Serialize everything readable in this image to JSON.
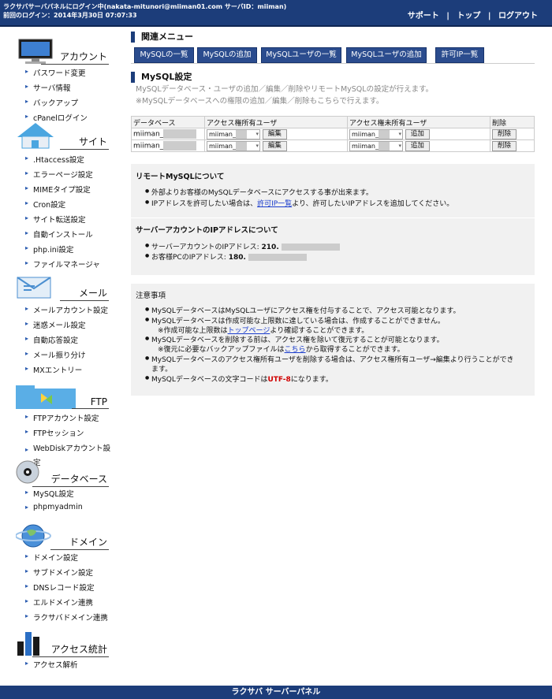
{
  "header": {
    "login_line1": "ラクサバサーバパネルにログイン中(nakata-mitunori@miiman01.com サーバID：miiman)",
    "login_line2": "前回のログイン：2014年3月30日 07:07:33",
    "links": [
      "サポート",
      "トップ",
      "ログアウト"
    ],
    "separator": "|"
  },
  "sidebar": {
    "account": {
      "title": "アカウント",
      "icon": "monitor-icon",
      "items": [
        "パスワード変更",
        "サーバ情報",
        "バックアップ",
        "cPanelログイン"
      ]
    },
    "site": {
      "title": "サイト",
      "icon": "house-icon",
      "items": [
        ".Htaccess設定",
        "エラーページ設定",
        "MIMEタイプ設定",
        "Cron設定",
        "サイト転送設定",
        "自動インストール",
        "php.ini設定",
        "ファイルマネージャ"
      ]
    },
    "mail": {
      "title": "メール",
      "icon": "envelope-icon",
      "items": [
        "メールアカウント設定",
        "迷惑メール設定",
        "自動応答設定",
        "メール振り分け",
        "MXエントリー"
      ]
    },
    "ftp": {
      "title": "FTP",
      "icon": "folder-icon",
      "items": [
        "FTPアカウント設定",
        "FTPセッション",
        "WebDiskアカウント設定"
      ]
    },
    "database": {
      "title": "データベース",
      "icon": "disc-icon",
      "items": [
        "MySQL設定",
        "phpmyadmin"
      ]
    },
    "domain": {
      "title": "ドメイン",
      "icon": "globe-icon",
      "items": [
        "ドメイン設定",
        "サブドメイン設定",
        "DNSレコード設定",
        "エルドメイン連携",
        "ラクサバドメイン連携"
      ]
    },
    "stats": {
      "title": "アクセス統計",
      "icon": "bar-chart-icon",
      "items": [
        "アクセス解析"
      ]
    }
  },
  "related": {
    "heading": "関連メニュー",
    "tabs": [
      "MySQLの一覧",
      "MySQLの追加",
      "MySQLユーザの一覧",
      "MySQLユーザの追加",
      "許可IP一覧"
    ]
  },
  "mysql": {
    "heading": "MySQL設定",
    "desc1": "MySQLデータベース・ユーザの追加／編集／削除やリモートMySQLの設定が行えます。",
    "desc2": "※MySQLデータベースへの権限の追加／編集／削除もこちらで行えます。",
    "table": {
      "headers": [
        "データベース",
        "アクセス権所有ユーザ",
        "アクセス権未所有ユーザ",
        "削除"
      ],
      "rows": [
        {
          "db": "miiman_",
          "owner": "miiman_",
          "nonowner": "miiman_",
          "edit": "編集",
          "add": "追加",
          "delete": "削除"
        },
        {
          "db": "miiman_",
          "owner": "miiman_",
          "nonowner": "miiman_",
          "edit": "編集",
          "add": "追加",
          "delete": "削除"
        }
      ]
    }
  },
  "remote": {
    "title": "リモートMySQLについて",
    "b1": "外部よりお客様のMySQLデータベースにアクセスする事が出来ます。",
    "b2_pre": "IPアドレスを許可したい場合は、",
    "b2_link": "許可IP一覧",
    "b2_post": "より、許可したいIPアドレスを追加してください。",
    "ip_title": "サーバーアカウントのIPアドレスについて",
    "ip1_label": "サーバーアカウントのIPアドレス: ",
    "ip1_value": "210.",
    "ip2_label": "お客様PCのIPアドレス: ",
    "ip2_value": "180."
  },
  "notes": {
    "title": "注意事項",
    "n1": "MySQLデータベースはMySQLユーザにアクセス権を付与することで、アクセス可能となります。",
    "n2": "MySQLデータベースは作成可能な上限数に達している場合は、作成することができません。",
    "n2_sub_pre": "※作成可能な上限数は",
    "n2_sub_link": "トップページ",
    "n2_sub_post": "より確認することができます。",
    "n3": "MySQLデータベースを削除する前は、アクセス権を除いて復元することが可能となります。",
    "n3_sub_pre": "※復元に必要なバックアップファイルは",
    "n3_sub_link": "こちら",
    "n3_sub_post": "から取得することができます。",
    "n4a": "MySQLデータベースのアクセス権所有ユーザを削除する場合は、アクセス権所有ユーザ→編集より行うことができ",
    "n4b": "ます。",
    "n5_pre": "MySQLデータベースの文字コードは",
    "n5_red": "UTF-8",
    "n5_post": "になります。"
  },
  "footer": {
    "text": "ラクサバ サーバーパネル"
  }
}
